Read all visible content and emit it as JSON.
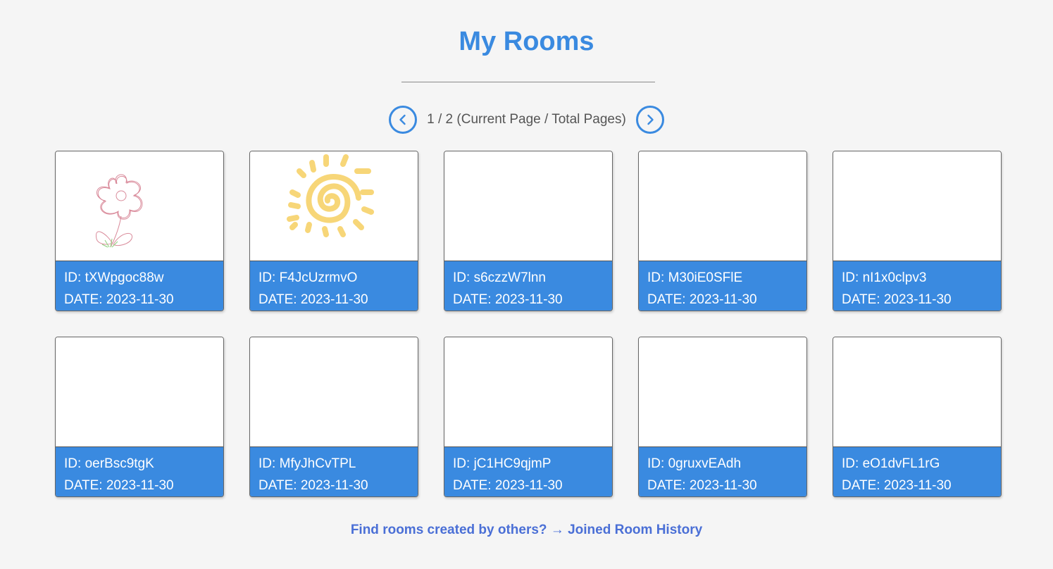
{
  "page": {
    "title": "My Rooms"
  },
  "pager": {
    "text": "1 / 2 (Current Page / Total Pages)",
    "current_page": 1,
    "total_pages": 2
  },
  "id_prefix": "ID: ",
  "date_prefix": "DATE: ",
  "rooms": [
    {
      "id": "tXWpgoc88w",
      "date": "2023-11-30",
      "thumbnail": "flower-drawing"
    },
    {
      "id": "F4JcUzrmvO",
      "date": "2023-11-30",
      "thumbnail": "sun-drawing"
    },
    {
      "id": "s6czzW7lnn",
      "date": "2023-11-30",
      "thumbnail": "blank"
    },
    {
      "id": "M30iE0SFlE",
      "date": "2023-11-30",
      "thumbnail": "blank"
    },
    {
      "id": "nI1x0clpv3",
      "date": "2023-11-30",
      "thumbnail": "blank"
    },
    {
      "id": "oerBsc9tgK",
      "date": "2023-11-30",
      "thumbnail": "blank"
    },
    {
      "id": "MfyJhCvTPL",
      "date": "2023-11-30",
      "thumbnail": "blank"
    },
    {
      "id": "jC1HC9qjmP",
      "date": "2023-11-30",
      "thumbnail": "blank"
    },
    {
      "id": "0gruxvEAdh",
      "date": "2023-11-30",
      "thumbnail": "blank"
    },
    {
      "id": "eO1dvFL1rG",
      "date": "2023-11-30",
      "thumbnail": "blank"
    }
  ],
  "footer": {
    "link_text": "Find rooms created by others? → Joined Room History"
  },
  "colors": {
    "accent": "#3a8ae0",
    "background": "#f5f5f5",
    "link": "#4a6fd6"
  }
}
